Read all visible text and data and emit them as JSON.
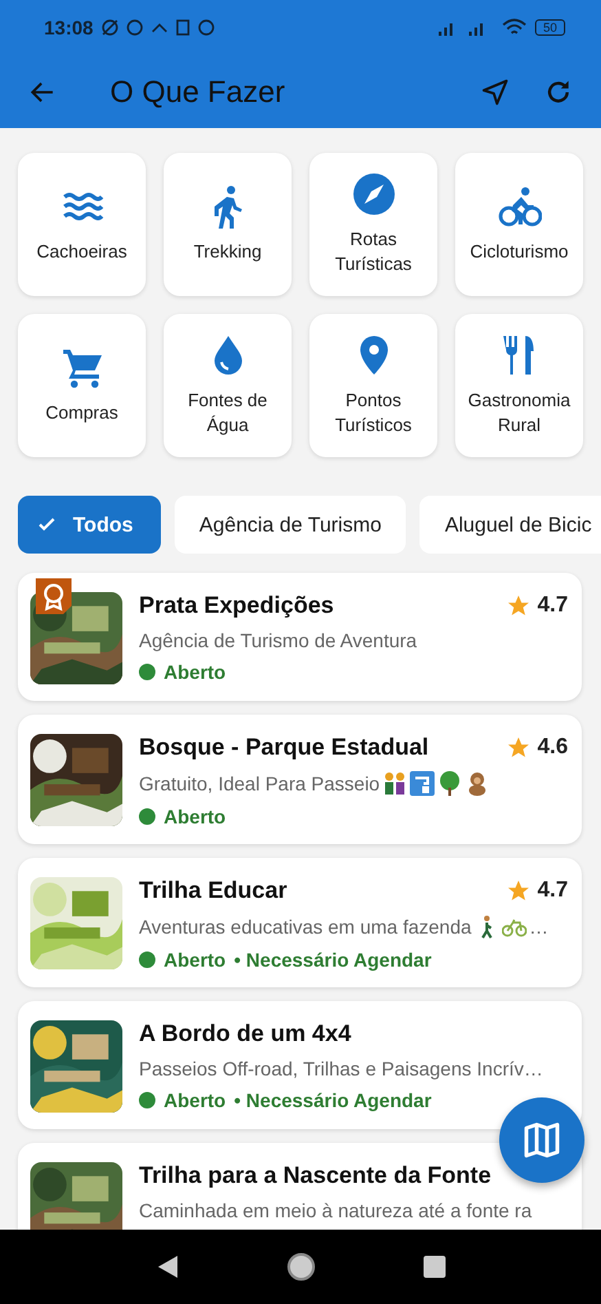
{
  "status_bar": {
    "time": "13:08",
    "battery": "50"
  },
  "app_bar": {
    "title": "O Que Fazer"
  },
  "categories": [
    {
      "label": "Cachoeiras"
    },
    {
      "label": "Trekking"
    },
    {
      "label": "Rotas Turísticas"
    },
    {
      "label": "Cicloturismo"
    },
    {
      "label": "Compras"
    },
    {
      "label": "Fontes de Água"
    },
    {
      "label": "Pontos Turísticos"
    },
    {
      "label": "Gastronomia Rural"
    }
  ],
  "filters": [
    {
      "label": "Todos",
      "selected": true
    },
    {
      "label": "Agência de Turismo",
      "selected": false
    },
    {
      "label": "Aluguel de Bicic",
      "selected": false
    }
  ],
  "places": [
    {
      "title": "Prata Expedições",
      "rating": "4.7",
      "description": "Agência de Turismo de Aventura",
      "status": "Aberto",
      "featured": true
    },
    {
      "title": "Bosque - Parque Estadual",
      "rating": "4.6",
      "description": "Gratuito, Ideal Para Passeio",
      "status": "Aberto",
      "featured": false
    },
    {
      "title": "Trilha Educar",
      "rating": "4.7",
      "description": "Aventuras educativas em uma fazenda",
      "desc_tail": "…",
      "status": "Aberto",
      "note": "• Necessário Agendar",
      "featured": false
    },
    {
      "title": "A Bordo de um 4x4",
      "description": "Passeios Off-road, Trilhas e Paisagens Incrív…",
      "status": "Aberto",
      "note": "• Necessário Agendar",
      "featured": false
    },
    {
      "title": "Trilha para a Nascente da Fonte",
      "description": "Caminhada em meio à natureza até a fonte ra",
      "featured": false
    }
  ]
}
